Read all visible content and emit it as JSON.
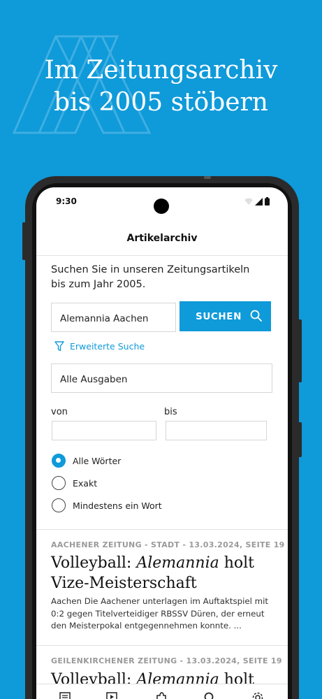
{
  "promo": {
    "headline_line1": "Im Zeitungsarchiv",
    "headline_line2": "bis 2005 stöbern"
  },
  "status_bar": {
    "time": "9:30"
  },
  "app_bar": {
    "title": "Artikelarchiv"
  },
  "search": {
    "intro": "Suchen Sie in unseren Zeitungsartikeln bis zum Jahr 2005.",
    "query_value": "Alemannia Aachen",
    "button_label": "SUCHEN",
    "advanced_label": "Erweiterte Suche",
    "edition_value": "Alle Ausgaben",
    "from_label": "von",
    "to_label": "bis",
    "from_value": "",
    "to_value": ""
  },
  "match_options": [
    {
      "label": "Alle Wörter",
      "selected": true
    },
    {
      "label": "Exakt",
      "selected": false
    },
    {
      "label": "Mindestens ein Wort",
      "selected": false
    }
  ],
  "results": [
    {
      "meta": "AACHENER ZEITUNG - STADT - 13.03.2024, SEITE 19",
      "title_pre": "Volleyball: ",
      "title_em": "Alemannia",
      "title_post": " holt Vize-Meisterschaft",
      "snippet": "Aachen Die Aachener unterlagen im Auftaktspiel mit 0:2 gegen Titelverteidiger RBSSV Düren, der erneut den Meisterpokal entgegennehmen konnte. ..."
    },
    {
      "meta": "GEILENKIRCHENER ZEITUNG - 13.03.2024, SEITE 19",
      "title_pre": "Volleyball: ",
      "title_em": "Alemannia",
      "title_post": " holt"
    }
  ],
  "colors": {
    "accent": "#0f9ad9",
    "background": "#0f9ad9"
  },
  "icons": [
    "search-icon",
    "filter-icon",
    "news-icon",
    "play-icon",
    "puzzle-icon",
    "search-nav-icon",
    "gear-icon"
  ]
}
